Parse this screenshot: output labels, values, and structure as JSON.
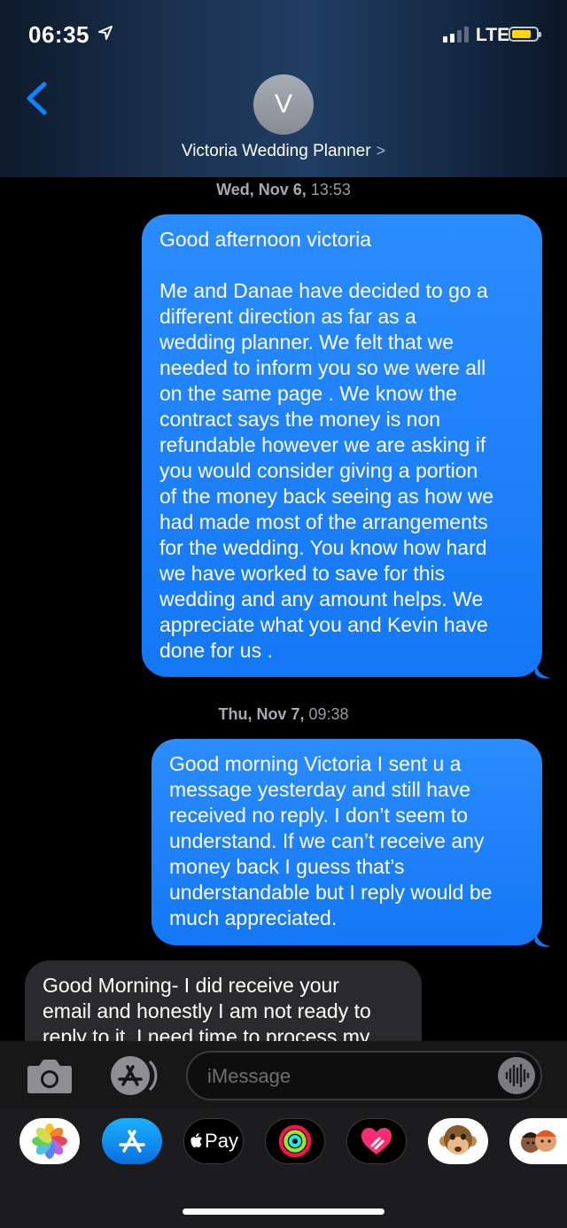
{
  "status_bar": {
    "time": "06:35",
    "network": "LTE",
    "battery_color": "#ffd60a"
  },
  "header": {
    "avatar_initial": "V",
    "contact_name": "Victoria Wedding Planner",
    "chevron": ">"
  },
  "conversation": [
    {
      "type": "timestamp",
      "day": "Wed, Nov 6,",
      "time": "13:53"
    },
    {
      "type": "outgoing",
      "text": "Good afternoon victoria\n\nMe and Danae have decided to go a\ndifferent direction as far as  a\nwedding planner. We felt that we\nneeded to inform you so we were all\non the same page . We know the\ncontract says the money is non\nrefundable however we are asking if\nyou would consider giving  a portion\nof the money back seeing as how we\nhad made most of the arrangements\nfor the wedding. You know how hard\nwe have worked to save for this\nwedding and any amount helps. We\nappreciate what you and Kevin have\ndone for us ."
    },
    {
      "type": "timestamp",
      "day": "Thu, Nov 7,",
      "time": "09:38"
    },
    {
      "type": "outgoing",
      "text": "Good morning Victoria I sent u a\nmessage yesterday and still have\nreceived no reply. I don’t seem to\nunderstand. If we can’t receive any\nmoney back I guess that’s\nunderstandable but I reply would be\nmuch appreciated."
    },
    {
      "type": "incoming",
      "text": "Good Morning- I did receive your\nemail and honestly I am not ready to\nreply to it. I need time to process my"
    }
  ],
  "input": {
    "placeholder": "iMessage"
  },
  "app_drawer": [
    {
      "name": "photos-app",
      "icon": "photos-icon"
    },
    {
      "name": "app-store-app",
      "icon": "app-store-icon"
    },
    {
      "name": "apple-pay-app",
      "icon": "apple-pay-icon",
      "label": "Pay"
    },
    {
      "name": "activity-app",
      "icon": "activity-rings-icon"
    },
    {
      "name": "digital-touch-app",
      "icon": "heart-icon"
    },
    {
      "name": "animoji-app",
      "icon": "monkey-icon"
    },
    {
      "name": "memoji-app",
      "icon": "memoji-icon"
    }
  ],
  "colors": {
    "outgoing_bubble": "#1a80fa",
    "incoming_bubble": "#2a2a2c",
    "accent": "#0a84ff"
  }
}
